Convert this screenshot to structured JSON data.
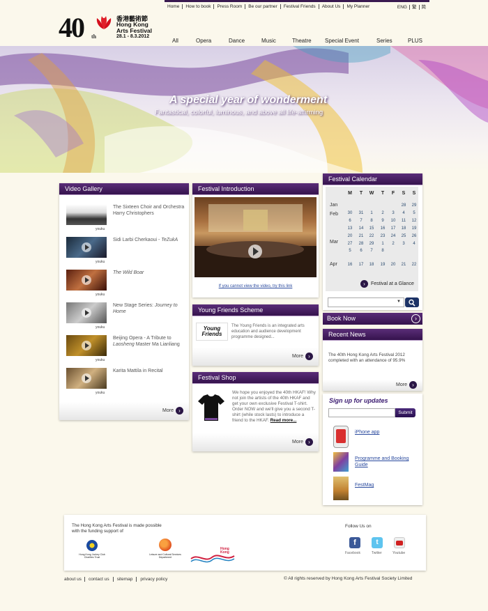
{
  "top_links": [
    "Home",
    "How to book",
    "Press Room",
    "Be our partner",
    "Festival Friends",
    "About Us",
    "My Planner"
  ],
  "languages": [
    "ENG",
    "繁",
    "简"
  ],
  "logo": {
    "number": "40",
    "suffix": "th",
    "chinese": "香港藝術節",
    "name_line1": "Hong Kong",
    "name_line2": "Arts Festival",
    "dates": "28.1 - 8.3.2012"
  },
  "main_nav": [
    "All",
    "Opera",
    "Dance",
    "Music",
    "Theatre",
    "Special Event",
    "Series",
    "PLUS"
  ],
  "banner": {
    "title": "A special year of wonderment",
    "subtitle": "Fantastical, colorful, luminous, and above all life-affirming"
  },
  "video_gallery": {
    "title": "Video Gallery",
    "items": [
      {
        "text": "The Sixteen Choir and Orchestra Harry Christophers",
        "source": "youku"
      },
      {
        "text": "Sidi Larbi Cherkaoui - TeZukA",
        "source": "youku"
      },
      {
        "text": "The Wild Boar",
        "source": "youku"
      },
      {
        "text": "New Stage Series: Journey to Home",
        "source": "youku"
      },
      {
        "text": "Beijing Opera - A Tribute to Laosheng Master Ma Lianliang",
        "source": "youku"
      },
      {
        "text": "Karita Mattila in Recital",
        "source": "youku"
      }
    ],
    "more": "More"
  },
  "festival_intro": {
    "title": "Festival Introduction",
    "link": "If you cannot view the video, try this link"
  },
  "young_friends": {
    "title": "Young Friends Scheme",
    "logo_text": "Young Friends",
    "text": "The Young Friends is an integrated arts education and audience development programme designed...",
    "more": "More"
  },
  "festival_shop": {
    "title": "Festival Shop",
    "text": "We hope you enjoyed the 40th HKAF! Why not join the artists of the 40th HKAF and get your own exclusive Festival T-shirt. Order NOW and we'll give you a second T-shirt (while stock lasts) to introduce a friend to the HKAF.",
    "read_more": "Read more...",
    "more": "More"
  },
  "calendar": {
    "title": "Festival Calendar",
    "weekdays": [
      "M",
      "T",
      "W",
      "T",
      "F",
      "S",
      "S"
    ],
    "months": [
      "Jan",
      "Feb",
      "Mar",
      "Apr"
    ],
    "rows": [
      [
        "",
        "",
        "",
        "",
        "",
        "28",
        "29"
      ],
      [
        "30",
        "31",
        "1",
        "2",
        "3",
        "4",
        "5"
      ],
      [
        "6",
        "7",
        "8",
        "9",
        "10",
        "11",
        "12"
      ],
      [
        "13",
        "14",
        "15",
        "16",
        "17",
        "18",
        "19"
      ],
      [
        "20",
        "21",
        "22",
        "23",
        "24",
        "25",
        "26"
      ],
      [
        "27",
        "28",
        "29",
        "1",
        "2",
        "3",
        "4"
      ],
      [
        "5",
        "6",
        "7",
        "8",
        "",
        "",
        ""
      ],
      [
        "16",
        "17",
        "18",
        "19",
        "20",
        "21",
        "22"
      ]
    ],
    "glance": "Festival at a Glance"
  },
  "search": {
    "value": ""
  },
  "book_now": "Book Now",
  "recent_news": {
    "title": "Recent News",
    "text": "The 40th Hong Kong Arts Festival 2012 completed with an attendance of 95.9%",
    "more": "More"
  },
  "signup": {
    "title": "Sign up for updates",
    "placeholder": "",
    "submit": "Submit"
  },
  "apps": [
    {
      "label": "iPhone app"
    },
    {
      "label": "Programme and Booking Guide"
    },
    {
      "label": "FestMag"
    }
  ],
  "funding": {
    "text": "The Hong Kong Arts Festival is made possible with the funding support of",
    "sponsors": [
      "Hong Kong Jockey Club Charities Trust",
      "Leisure and Cultural Services Department",
      "Hong Kong"
    ]
  },
  "follow": {
    "title": "Follow Us on",
    "items": [
      "Facebook",
      "Twitter",
      "Youtube"
    ]
  },
  "footer": {
    "links": [
      "about us",
      "contact us",
      "sitemap",
      "privacy policy"
    ],
    "copyright": "© All rights reserved by Hong Kong Arts Festival Society Limited"
  },
  "colors": {
    "purple_dark": "#35134d",
    "purple": "#5a2d78",
    "background": "#fbf8ec",
    "link_blue": "#2a4a9e"
  }
}
